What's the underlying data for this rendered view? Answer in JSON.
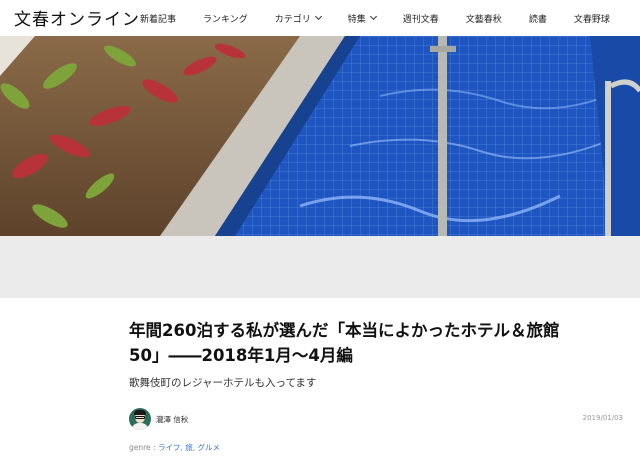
{
  "site": {
    "logo": "文春オンライン"
  },
  "nav": {
    "items": [
      {
        "label": "新着記事",
        "has_dropdown": false
      },
      {
        "label": "ランキング",
        "has_dropdown": false
      },
      {
        "label": "カテゴリ",
        "has_dropdown": true
      },
      {
        "label": "特集",
        "has_dropdown": true
      },
      {
        "label": "週刊文春",
        "has_dropdown": false
      },
      {
        "label": "文藝春秋",
        "has_dropdown": false
      },
      {
        "label": "読書",
        "has_dropdown": false
      },
      {
        "label": "文春野球",
        "has_dropdown": false
      }
    ]
  },
  "article": {
    "title_line1": "年間260泊する私が選んだ「本当によかったホテル＆旅館",
    "title_line2": "50」――2018年1月～4月編",
    "subtitle": "歌舞伎町のレジャーホテルも入ってます",
    "author": "瀧澤 信秋",
    "date": "2019/01/03",
    "genre_label": "genre : ",
    "genres": [
      "ライフ",
      "旅",
      "グルメ"
    ]
  },
  "colors": {
    "pool_blue": "#1d4fb5",
    "link_blue": "#2a73c9",
    "gray_band": "#ebebeb"
  },
  "icons": {
    "dropdown": "chevron-down-icon"
  }
}
